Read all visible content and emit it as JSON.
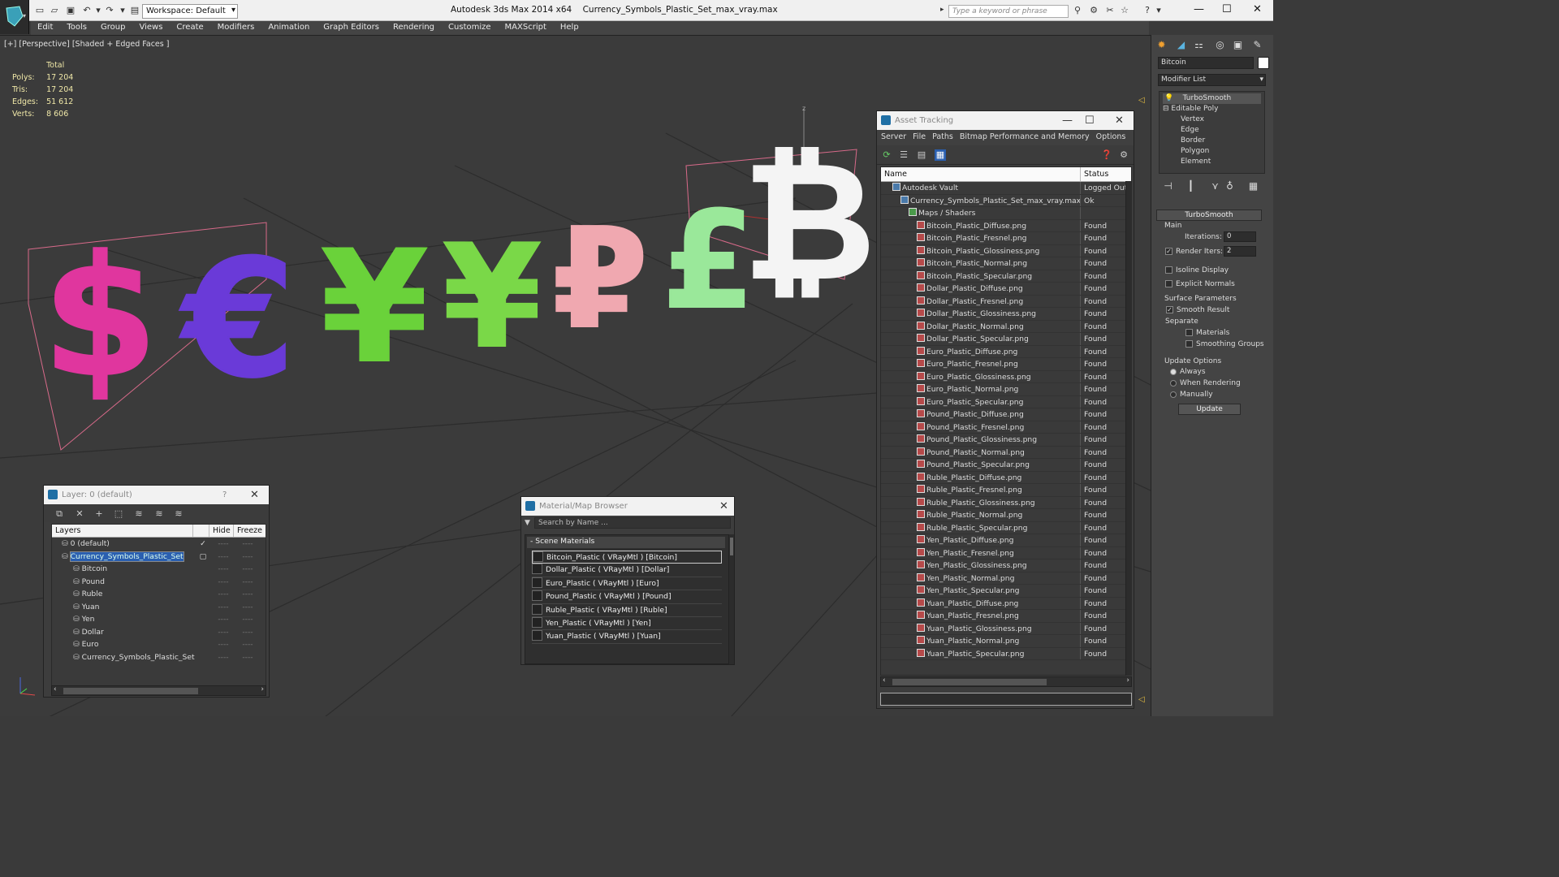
{
  "app": {
    "title": "Autodesk 3ds Max  2014 x64",
    "file": "Currency_Symbols_Plastic_Set_max_vray.max",
    "workspace": "Workspace: Default",
    "search_placeholder": "Type a keyword or phrase"
  },
  "menu": [
    "Edit",
    "Tools",
    "Group",
    "Views",
    "Create",
    "Modifiers",
    "Animation",
    "Graph Editors",
    "Rendering",
    "Customize",
    "MAXScript",
    "Help"
  ],
  "viewport": {
    "label": "[+] [Perspective] [Shaded + Edged Faces ]",
    "stats": {
      "header": "Total",
      "rows": [
        {
          "label": "Polys:",
          "value": "17 204"
        },
        {
          "label": "Tris:",
          "value": "17 204"
        },
        {
          "label": "Edges:",
          "value": "51 612"
        },
        {
          "label": "Verts:",
          "value": "8 606"
        }
      ]
    },
    "symbols": [
      "$",
      "€",
      "¥",
      "¥",
      "₽",
      "£",
      "₿"
    ],
    "symbol_colors": [
      "#e0369e",
      "#6a3ad8",
      "#6ad23a",
      "#7ad848",
      "#f0a8b0",
      "#9ae89a",
      "#f4f4f4"
    ],
    "axis_z": "z"
  },
  "command_panel": {
    "object_name": "Bitcoin",
    "modifier_list": "Modifier List",
    "stack": [
      "TurboSmooth",
      "Editable Poly",
      "Vertex",
      "Edge",
      "Border",
      "Polygon",
      "Element"
    ],
    "rollout_title": "TurboSmooth",
    "main_label": "Main",
    "iterations_label": "Iterations:",
    "iterations_value": "0",
    "render_iters_label": "Render Iters:",
    "render_iters_value": "2",
    "isoline": "Isoline Display",
    "explicit_normals": "Explicit Normals",
    "surface_params": "Surface Parameters",
    "smooth_result": "Smooth Result",
    "separate": "Separate",
    "materials": "Materials",
    "smoothing_groups": "Smoothing Groups",
    "update_options": "Update Options",
    "always": "Always",
    "when_rendering": "When Rendering",
    "manually": "Manually",
    "update_button": "Update"
  },
  "asset_tracking": {
    "title": "Asset Tracking",
    "menu": [
      "Server",
      "File",
      "Paths",
      "Bitmap Performance and Memory",
      "Options"
    ],
    "col_name": "Name",
    "col_status": "Status",
    "rows": [
      {
        "name": "Autodesk Vault",
        "status": "Logged Out ...",
        "indent": 1,
        "icon": "vault"
      },
      {
        "name": "Currency_Symbols_Plastic_Set_max_vray.max",
        "status": "Ok",
        "indent": 2,
        "icon": "max"
      },
      {
        "name": "Maps / Shaders",
        "status": "",
        "indent": 3,
        "icon": "maps"
      },
      {
        "name": "Bitcoin_Plastic_Diffuse.png",
        "status": "Found",
        "indent": 4,
        "icon": "png"
      },
      {
        "name": "Bitcoin_Plastic_Fresnel.png",
        "status": "Found",
        "indent": 4,
        "icon": "png"
      },
      {
        "name": "Bitcoin_Plastic_Glossiness.png",
        "status": "Found",
        "indent": 4,
        "icon": "png"
      },
      {
        "name": "Bitcoin_Plastic_Normal.png",
        "status": "Found",
        "indent": 4,
        "icon": "png"
      },
      {
        "name": "Bitcoin_Plastic_Specular.png",
        "status": "Found",
        "indent": 4,
        "icon": "png"
      },
      {
        "name": "Dollar_Plastic_Diffuse.png",
        "status": "Found",
        "indent": 4,
        "icon": "png"
      },
      {
        "name": "Dollar_Plastic_Fresnel.png",
        "status": "Found",
        "indent": 4,
        "icon": "png"
      },
      {
        "name": "Dollar_Plastic_Glossiness.png",
        "status": "Found",
        "indent": 4,
        "icon": "png"
      },
      {
        "name": "Dollar_Plastic_Normal.png",
        "status": "Found",
        "indent": 4,
        "icon": "png"
      },
      {
        "name": "Dollar_Plastic_Specular.png",
        "status": "Found",
        "indent": 4,
        "icon": "png"
      },
      {
        "name": "Euro_Plastic_Diffuse.png",
        "status": "Found",
        "indent": 4,
        "icon": "png"
      },
      {
        "name": "Euro_Plastic_Fresnel.png",
        "status": "Found",
        "indent": 4,
        "icon": "png"
      },
      {
        "name": "Euro_Plastic_Glossiness.png",
        "status": "Found",
        "indent": 4,
        "icon": "png"
      },
      {
        "name": "Euro_Plastic_Normal.png",
        "status": "Found",
        "indent": 4,
        "icon": "png"
      },
      {
        "name": "Euro_Plastic_Specular.png",
        "status": "Found",
        "indent": 4,
        "icon": "png"
      },
      {
        "name": "Pound_Plastic_Diffuse.png",
        "status": "Found",
        "indent": 4,
        "icon": "png"
      },
      {
        "name": "Pound_Plastic_Fresnel.png",
        "status": "Found",
        "indent": 4,
        "icon": "png"
      },
      {
        "name": "Pound_Plastic_Glossiness.png",
        "status": "Found",
        "indent": 4,
        "icon": "png"
      },
      {
        "name": "Pound_Plastic_Normal.png",
        "status": "Found",
        "indent": 4,
        "icon": "png"
      },
      {
        "name": "Pound_Plastic_Specular.png",
        "status": "Found",
        "indent": 4,
        "icon": "png"
      },
      {
        "name": "Ruble_Plastic_Diffuse.png",
        "status": "Found",
        "indent": 4,
        "icon": "png"
      },
      {
        "name": "Ruble_Plastic_Fresnel.png",
        "status": "Found",
        "indent": 4,
        "icon": "png"
      },
      {
        "name": "Ruble_Plastic_Glossiness.png",
        "status": "Found",
        "indent": 4,
        "icon": "png"
      },
      {
        "name": "Ruble_Plastic_Normal.png",
        "status": "Found",
        "indent": 4,
        "icon": "png"
      },
      {
        "name": "Ruble_Plastic_Specular.png",
        "status": "Found",
        "indent": 4,
        "icon": "png"
      },
      {
        "name": "Yen_Plastic_Diffuse.png",
        "status": "Found",
        "indent": 4,
        "icon": "png"
      },
      {
        "name": "Yen_Plastic_Fresnel.png",
        "status": "Found",
        "indent": 4,
        "icon": "png"
      },
      {
        "name": "Yen_Plastic_Glossiness.png",
        "status": "Found",
        "indent": 4,
        "icon": "png"
      },
      {
        "name": "Yen_Plastic_Normal.png",
        "status": "Found",
        "indent": 4,
        "icon": "png"
      },
      {
        "name": "Yen_Plastic_Specular.png",
        "status": "Found",
        "indent": 4,
        "icon": "png"
      },
      {
        "name": "Yuan_Plastic_Diffuse.png",
        "status": "Found",
        "indent": 4,
        "icon": "png"
      },
      {
        "name": "Yuan_Plastic_Fresnel.png",
        "status": "Found",
        "indent": 4,
        "icon": "png"
      },
      {
        "name": "Yuan_Plastic_Glossiness.png",
        "status": "Found",
        "indent": 4,
        "icon": "png"
      },
      {
        "name": "Yuan_Plastic_Normal.png",
        "status": "Found",
        "indent": 4,
        "icon": "png"
      },
      {
        "name": "Yuan_Plastic_Specular.png",
        "status": "Found",
        "indent": 4,
        "icon": "png"
      }
    ]
  },
  "layer_manager": {
    "title": "Layer: 0 (default)",
    "help": "?",
    "col_layers": "Layers",
    "col_hide": "Hide",
    "col_freeze": "Freeze",
    "rows": [
      {
        "name": "0 (default)",
        "indent": 1,
        "selected": false,
        "check": true
      },
      {
        "name": "Currency_Symbols_Plastic_Set",
        "indent": 1,
        "selected": true,
        "check": false
      },
      {
        "name": "Bitcoin",
        "indent": 2,
        "selected": false,
        "check": false
      },
      {
        "name": "Pound",
        "indent": 2,
        "selected": false,
        "check": false
      },
      {
        "name": "Ruble",
        "indent": 2,
        "selected": false,
        "check": false
      },
      {
        "name": "Yuan",
        "indent": 2,
        "selected": false,
        "check": false
      },
      {
        "name": "Yen",
        "indent": 2,
        "selected": false,
        "check": false
      },
      {
        "name": "Dollar",
        "indent": 2,
        "selected": false,
        "check": false
      },
      {
        "name": "Euro",
        "indent": 2,
        "selected": false,
        "check": false
      },
      {
        "name": "Currency_Symbols_Plastic_Set",
        "indent": 2,
        "selected": false,
        "check": false
      }
    ],
    "dash": "----"
  },
  "material_browser": {
    "title": "Material/Map Browser",
    "search_placeholder": "Search by Name ...",
    "group": "- Scene Materials",
    "items": [
      "Bitcoin_Plastic  ( VRayMtl ) [Bitcoin]",
      "Dollar_Plastic  ( VRayMtl ) [Dollar]",
      "Euro_Plastic  ( VRayMtl ) [Euro]",
      "Pound_Plastic  ( VRayMtl ) [Pound]",
      "Ruble_Plastic  ( VRayMtl ) [Ruble]",
      "Yen_Plastic  ( VRayMtl ) [Yen]",
      "Yuan_Plastic  ( VRayMtl ) [Yuan]"
    ]
  }
}
